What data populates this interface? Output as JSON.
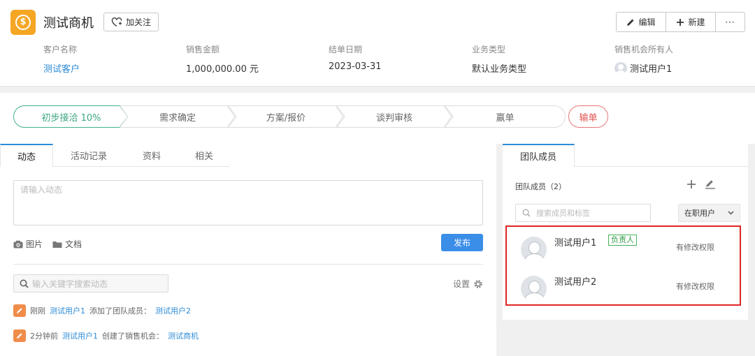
{
  "header": {
    "title": "测试商机",
    "follow_label": "加关注",
    "edit_label": "编辑",
    "new_label": "新建",
    "more_label": "···",
    "fields": [
      {
        "label": "客户名称",
        "value": "测试客户"
      },
      {
        "label": "销售金额",
        "value": "1,000,000.00 元"
      },
      {
        "label": "结单日期",
        "value": "2023-03-31"
      },
      {
        "label": "业务类型",
        "value": "默认业务类型"
      },
      {
        "label": "销售机会所有人",
        "value": "测试用户1"
      }
    ]
  },
  "stages": {
    "items": [
      "初步接洽 10%",
      "需求确定",
      "方案/报价",
      "谈判审核",
      "赢单"
    ],
    "active_index": 0,
    "lost_label": "输单"
  },
  "activity": {
    "tabs": [
      "动态",
      "活动记录",
      "资料",
      "相关"
    ],
    "composer_placeholder": "请输入动态",
    "attach_image": "图片",
    "attach_doc": "文档",
    "publish_label": "发布",
    "search_placeholder": "输入关键字搜索动态",
    "settings_label": "设置",
    "feed": [
      {
        "time": "刚刚",
        "user": "测试用户1",
        "action": "添加了团队成员：",
        "target": "测试用户2"
      },
      {
        "time": "2分钟前",
        "user": "测试用户1",
        "action": "创建了销售机会：",
        "target": "测试商机"
      }
    ]
  },
  "team": {
    "tab_label": "团队成员",
    "count_label": "团队成员（2）",
    "search_placeholder": "搜索成员和标签",
    "status_filter": "在职用户",
    "members": [
      {
        "name": "测试用户1",
        "badge": "负责人",
        "permission": "有修改权限"
      },
      {
        "name": "测试用户2",
        "badge": "",
        "permission": "有修改权限"
      }
    ]
  },
  "colors": {
    "accent": "#2c8bd6",
    "active_stage": "#3aa77f",
    "lost": "#e05050",
    "highlight_box": "#e02424",
    "app_icon": "#f5a623"
  }
}
